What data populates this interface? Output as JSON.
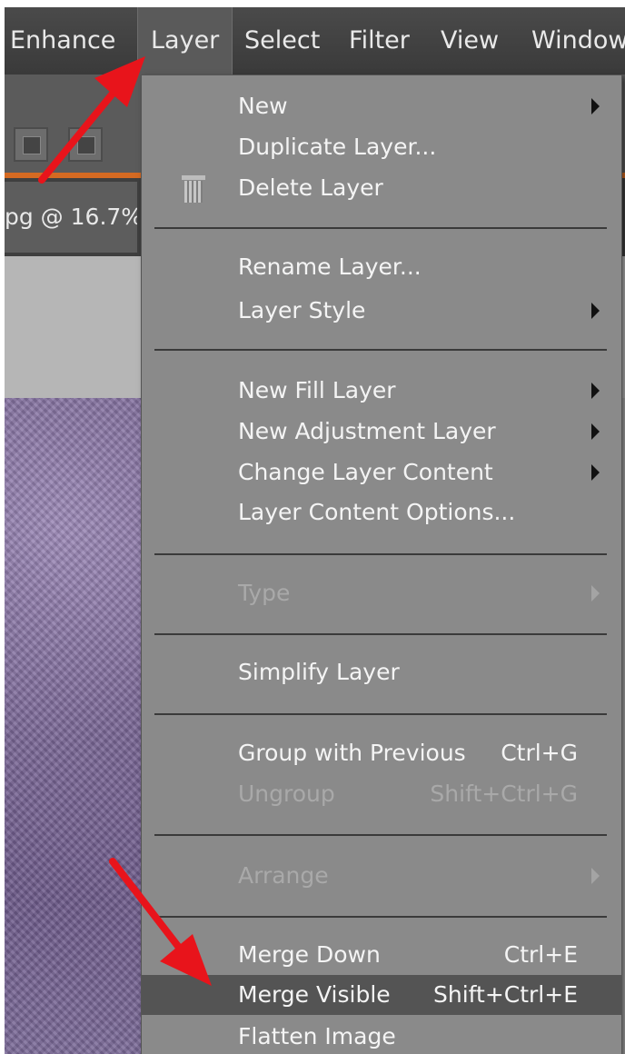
{
  "menubar": {
    "items": [
      {
        "label": "Enhance"
      },
      {
        "label": "Layer"
      },
      {
        "label": "Select"
      },
      {
        "label": "Filter"
      },
      {
        "label": "View"
      },
      {
        "label": "Window"
      }
    ]
  },
  "doc_tab": {
    "title": "pg @ 16.7%"
  },
  "layer_menu": {
    "items": {
      "new": {
        "label": "New"
      },
      "duplicate_layer": {
        "label": "Duplicate Layer..."
      },
      "delete_layer": {
        "label": "Delete Layer"
      },
      "rename_layer": {
        "label": "Rename Layer..."
      },
      "layer_style": {
        "label": "Layer Style"
      },
      "new_fill_layer": {
        "label": "New Fill Layer"
      },
      "new_adjustment_layer": {
        "label": "New Adjustment Layer"
      },
      "change_layer_content": {
        "label": "Change Layer Content"
      },
      "layer_content_options": {
        "label": "Layer Content Options..."
      },
      "type": {
        "label": "Type"
      },
      "simplify_layer": {
        "label": "Simplify Layer"
      },
      "group_with_previous": {
        "label": "Group with Previous",
        "shortcut": "Ctrl+G"
      },
      "ungroup": {
        "label": "Ungroup",
        "shortcut": "Shift+Ctrl+G"
      },
      "arrange": {
        "label": "Arrange"
      },
      "merge_down": {
        "label": "Merge Down",
        "shortcut": "Ctrl+E"
      },
      "merge_visible": {
        "label": "Merge Visible",
        "shortcut": "Shift+Ctrl+E"
      },
      "flatten_image": {
        "label": "Flatten Image"
      }
    }
  },
  "colors": {
    "highlight": "#545454",
    "menu_bg": "#8a8a8a",
    "accent_orange": "#d56a22",
    "annotation_red": "#e8141b"
  }
}
